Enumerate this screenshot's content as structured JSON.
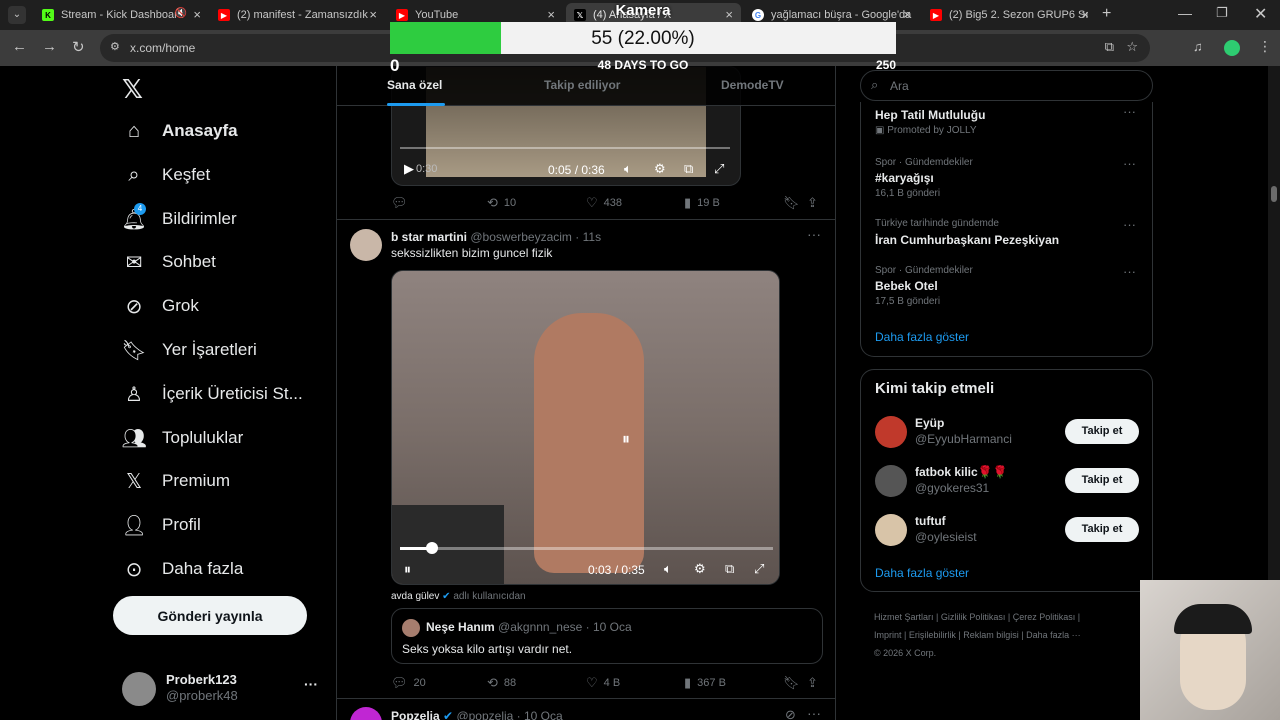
{
  "browser": {
    "tabs": [
      {
        "label": "Stream - Kick Dashboard"
      },
      {
        "label": "(2) manifest - Zamansızdık"
      },
      {
        "label": "YouTube"
      },
      {
        "label": "(4) Anasayfa / X"
      },
      {
        "label": "yağlamacı büşra - Google'da"
      },
      {
        "label": "(2) Big5 2. Sezon GRUP6 Sı"
      }
    ],
    "url": "x.com/home"
  },
  "counter": {
    "title": "Kamera",
    "progress_text": "55 (22.00%)",
    "progress_fraction": 0.22,
    "min": "0",
    "days": "48 DAYS TO GO",
    "max": "250"
  },
  "sidebar": {
    "notification_count": "4",
    "items": [
      {
        "label": "Anasayfa"
      },
      {
        "label": "Keşfet"
      },
      {
        "label": "Bildirimler"
      },
      {
        "label": "Sohbet"
      },
      {
        "label": "Grok"
      },
      {
        "label": "Yer İşaretleri"
      },
      {
        "label": "İçerik Üreticisi St..."
      },
      {
        "label": "Topluluklar"
      },
      {
        "label": "Premium"
      },
      {
        "label": "Profil"
      },
      {
        "label": "Daha fazla"
      }
    ],
    "post_button": "Gönderi yayınla",
    "account": {
      "name": "Proberk123",
      "handle": "@proberk48",
      "more": "···"
    }
  },
  "feed": {
    "tabs": [
      "Sana özel",
      "Takip ediliyor",
      "DemodeTV"
    ],
    "tweet1": {
      "video_time": "0:05 / 0:36",
      "elapsed": "0:30",
      "retweets": "10",
      "likes": "438",
      "views": "19 B"
    },
    "tweet2": {
      "name": "b star martini",
      "handle": "@boswerbeyzacim",
      "time": "· 11s",
      "text": "sekssizlikten bizim guncel fizik",
      "video_time": "0:03 / 0:35",
      "video_progress": 0.086,
      "credit_name": "avda gülev",
      "credit_label": "adlı kullanıcıdan",
      "quote": {
        "name": "Neşe Hanım",
        "handle": "@akgnnn_nese",
        "time": "· 10 Oca",
        "text": "Seks yoksa kilo artışı vardır net."
      },
      "replies": "20",
      "retweets": "88",
      "likes": "4 B",
      "views": "367 B"
    },
    "tweet3": {
      "name": "Popzelia",
      "handle": "@popzelia",
      "time": "· 10 Oca"
    }
  },
  "right": {
    "search_placeholder": "Ara",
    "trends": [
      {
        "context": "",
        "title": "Hep Tatil Mutluluğu",
        "meta": "Promoted by JOLLY"
      },
      {
        "context": "Spor · Gündemdekiler",
        "title": "#karyağışı",
        "meta": "16,1 B gönderi"
      },
      {
        "context": "Türkiye tarihinde gündemde",
        "title": "İran Cumhurbaşkanı Pezeşkiyan",
        "meta": ""
      },
      {
        "context": "Spor · Gündemdekiler",
        "title": "Bebek Otel",
        "meta": "17,5 B gönderi"
      }
    ],
    "show_more": "Daha fazla göster",
    "who_title": "Kimi takip etmeli",
    "who": [
      {
        "name": "Eyüp",
        "handle": "@EyyubHarmanci",
        "button": "Takip et"
      },
      {
        "name": "fatbok kilic🌹🌹",
        "handle": "@gyokeres31",
        "button": "Takip et"
      },
      {
        "name": "tuftuf",
        "handle": "@oylesieist",
        "button": "Takip et"
      }
    ],
    "who_more": "Daha fazla göster",
    "footer": [
      "Hizmet Şartları",
      "Gizlilik Politikası",
      "Çerez Politikası",
      "Imprint",
      "Erişilebilirlik",
      "Reklam bilgisi",
      "Daha fazla ···",
      "© 2026 X Corp."
    ]
  },
  "colors": {
    "accent": "#1d9bf0",
    "progress": "#2ecc40"
  }
}
